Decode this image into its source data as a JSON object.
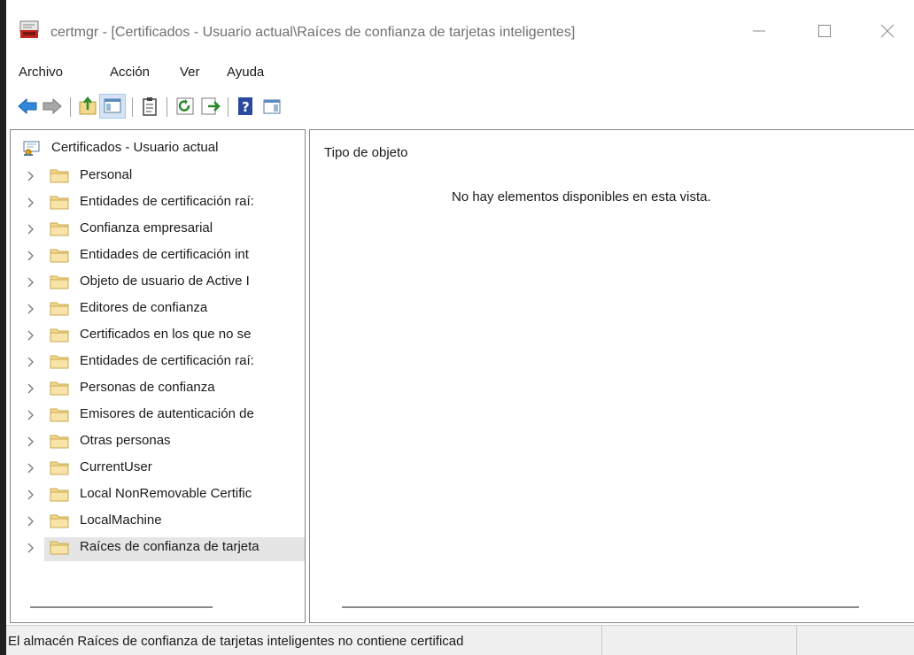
{
  "window": {
    "title": "certmgr - [Certificados - Usuario actual\\Raíces de confianza de tarjetas inteligentes]"
  },
  "menu": [
    "Archivo",
    "Acción",
    "Ver",
    "Ayuda"
  ],
  "toolbar": {
    "icons": [
      "back-arrow-icon",
      "forward-arrow-icon",
      "up-folder-icon",
      "show-hide-tree-icon",
      "clipboard-icon",
      "refresh-icon",
      "export-list-icon",
      "help-icon",
      "action-pane-icon"
    ]
  },
  "tree": {
    "root_label": "Certificados - Usuario actual",
    "items": [
      {
        "label": "Personal"
      },
      {
        "label": "Entidades de certificación raí:"
      },
      {
        "label": "Confianza empresarial"
      },
      {
        "label": "Entidades de certificación int"
      },
      {
        "label": "Objeto de usuario de Active I"
      },
      {
        "label": "Editores de confianza"
      },
      {
        "label": "Certificados en los que no se"
      },
      {
        "label": "Entidades de certificación raí:"
      },
      {
        "label": "Personas de confianza"
      },
      {
        "label": "Emisores de autenticación de"
      },
      {
        "label": "Otras personas"
      },
      {
        "label": "CurrentUser"
      },
      {
        "label": "Local NonRemovable Certific"
      },
      {
        "label": "LocalMachine"
      },
      {
        "label": "Raíces de confianza de tarjeta"
      }
    ]
  },
  "content": {
    "column_header": "Tipo de objeto",
    "empty_message": "No hay elementos disponibles en esta vista."
  },
  "status": {
    "text": "El almacén Raíces de confianza de tarjetas inteligentes no contiene certificad"
  },
  "colors": {
    "accent": "#3c8ee6",
    "folder": "#f3d88e",
    "selection": "#e5e5e5"
  }
}
